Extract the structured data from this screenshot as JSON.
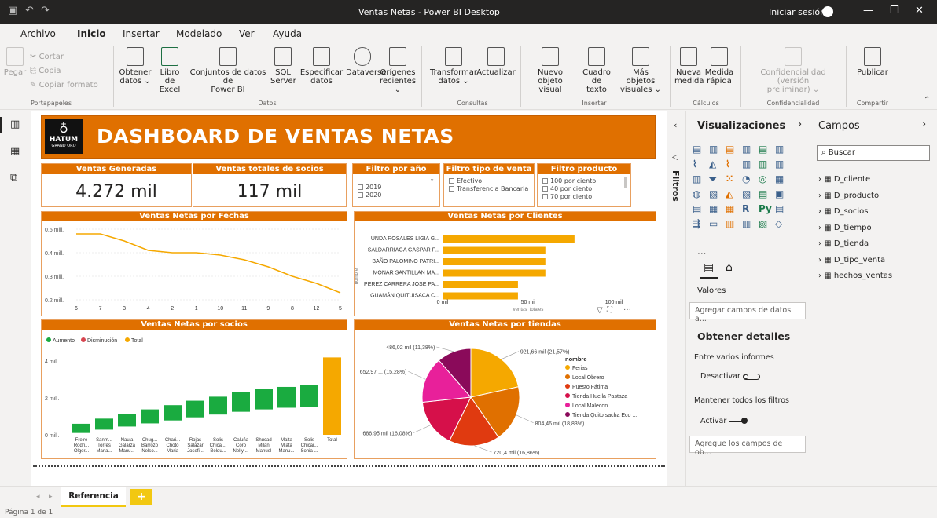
{
  "window": {
    "title": "Ventas Netas - Power BI Desktop",
    "signin": "Iniciar sesión"
  },
  "menu": [
    "Archivo",
    "Inicio",
    "Insertar",
    "Modelado",
    "Ver",
    "Ayuda"
  ],
  "ribbon": {
    "pegar": "Pegar",
    "cortar": "Cortar",
    "copia": "Copia",
    "copiar_formato": "Copiar formato",
    "obtener": "Obtener",
    "datos": "datos ⌄",
    "libro": "Libro de",
    "excel": "Excel",
    "conjuntos": "Conjuntos de datos de",
    "powerbi": "Power BI",
    "sql": "SQL",
    "server": "Server",
    "especificar": "Especificar",
    "datos2": "datos",
    "dataverse": "Dataverse",
    "origenes": "Orígenes",
    "recientes": "recientes ⌄",
    "transformar": "Transformar",
    "datos3": "datos ⌄",
    "actualizar": "Actualizar",
    "nuevo_objeto": "Nuevo objeto",
    "visual": "visual",
    "cuadro": "Cuadro de",
    "texto": "texto",
    "mas_objetos": "Más objetos",
    "visuales": "visuales ⌄",
    "nueva": "Nueva",
    "medida": "medida",
    "medida2": "Medida",
    "rapida": "rápida",
    "confidencialidad": "Confidencialidad (versión",
    "preliminar": "preliminar) ⌄",
    "publicar": "Publicar",
    "groups": [
      "Portapapeles",
      "Datos",
      "Consultas",
      "Insertar",
      "Cálculos",
      "Confidencialidad",
      "Compartir"
    ]
  },
  "dashboard": {
    "title": "DASHBOARD DE VENTAS NETAS",
    "logo": "HATUM",
    "logo_sub": "GRAND ORO",
    "kpi1_label": "Ventas Generadas",
    "kpi1_value": "4.272 mil",
    "kpi2_label": "Ventas totales de socios",
    "kpi2_value": "117 mil",
    "filtro_anio": {
      "label": "Filtro por año",
      "items": [
        "2019",
        "2020"
      ]
    },
    "filtro_tipo": {
      "label": "Filtro tipo de venta",
      "items": [
        "Efectivo",
        "Transferencia Bancaria"
      ]
    },
    "filtro_producto": {
      "label": "Filtro producto",
      "items": [
        "100 por ciento",
        "40 por ciento",
        "70 por ciento"
      ]
    }
  },
  "chart_data": [
    {
      "type": "line",
      "title": "Ventas Netas por Fechas",
      "categories": [
        "6",
        "7",
        "3",
        "4",
        "2",
        "1",
        "10",
        "11",
        "9",
        "8",
        "12",
        "5"
      ],
      "values": [
        0.48,
        0.48,
        0.45,
        0.41,
        0.4,
        0.4,
        0.39,
        0.37,
        0.34,
        0.3,
        0.27,
        0.23
      ],
      "yticks": [
        "0.5 mill.",
        "0.4 mill.",
        "0.3 mill.",
        "0.2 mill."
      ],
      "ylim": [
        0.2,
        0.5
      ],
      "color": "#f5a800"
    },
    {
      "type": "bar",
      "title": "Ventas Netas por Clientes",
      "categories": [
        "UNDA ROSALES LIGIA G...",
        "SALDARRIAGA GASPAR F...",
        "BAÑO PALOMINO PATRI...",
        "MONAR SANTILLAN MA...",
        "PEREZ CARRERA JOSE PA...",
        "GUAMÁN QUITUISACA C..."
      ],
      "values": [
        77,
        60,
        60,
        60,
        44,
        44
      ],
      "xticks": [
        "0 mil",
        "50 mil",
        "100 mil"
      ],
      "xlabel": "ventas_totales",
      "ylabel": "nombre",
      "xlim": [
        0,
        100
      ],
      "color": "#f5a800"
    },
    {
      "type": "bar",
      "title": "Ventas Netas por socios",
      "legend": [
        "Aumento",
        "Disminución",
        "Total"
      ],
      "legend_colors": [
        "#1aab40",
        "#d64550",
        "#f5a800"
      ],
      "categories": [
        "Freire Rodri... Olger...",
        "Sanm... Torres Maria...",
        "Naula Galarza Manu...",
        "Chug... Barrozo Nelso...",
        "Chari... Choto Maria",
        "Rojas Salazar Josefi...",
        "Solis Chicai... Belqu...",
        "Caluña Coro Nelly ...",
        "Shucad Milan Manuel",
        "Malta Miata Manu...",
        "Solis Chicai... Sonia ...",
        "Total"
      ],
      "steps": [
        0.1,
        0.28,
        0.45,
        0.62,
        0.78,
        0.95,
        1.1,
        1.25,
        1.38,
        1.47,
        1.5
      ],
      "ends": [
        0.6,
        0.88,
        1.12,
        1.38,
        1.61,
        1.85,
        2.07,
        2.33,
        2.48,
        2.6,
        2.72
      ],
      "total": 4.2,
      "yticks": [
        "4 mill.",
        "2 mill.",
        "0 mill."
      ],
      "ylim": [
        0,
        4.6
      ]
    },
    {
      "type": "pie",
      "title": "Ventas Netas por tiendas",
      "legend_title": "nombre",
      "labels": [
        "Ferias",
        "Local Obrero",
        "Puesto Fátima",
        "Tienda Huella Pastaza",
        "Local Malecon",
        "Tienda Quito sacha Eco ..."
      ],
      "values": [
        921.66,
        804.46,
        720.4,
        686.95,
        652.97,
        486.02
      ],
      "data_labels": [
        "921,66 mil (21,57%)",
        "804,46 mil (18,83%)",
        "720,4 mil (16,86%)",
        "686,95 mil (16,08%)",
        "652,97 ... (15,28%)",
        "486,02 mil (11,38%)"
      ],
      "colors": [
        "#f5a800",
        "#e07000",
        "#e03a10",
        "#d6104a",
        "#e8209a",
        "#8a0a5a"
      ]
    }
  ],
  "pane": {
    "filtros": "Filtros",
    "visualizaciones": "Visualizaciones",
    "campos": "Campos",
    "buscar": "Buscar",
    "valores": "Valores",
    "agregar_campos": "Agregar campos de datos a...",
    "obtener_detalles": "Obtener detalles",
    "entre_varios": "Entre varios informes",
    "desactivar": "Desactivar",
    "mantener": "Mantener todos los filtros",
    "activar": "Activar",
    "agregue": "Agregue los campos de ob...",
    "more": "...",
    "fields": [
      "D_cliente",
      "D_producto",
      "D_socios",
      "D_tiempo",
      "D_tienda",
      "D_tipo_venta",
      "hechos_ventas"
    ]
  },
  "tabs": {
    "page": "Referencia",
    "add": "+"
  },
  "status": "Página 1 de 1"
}
